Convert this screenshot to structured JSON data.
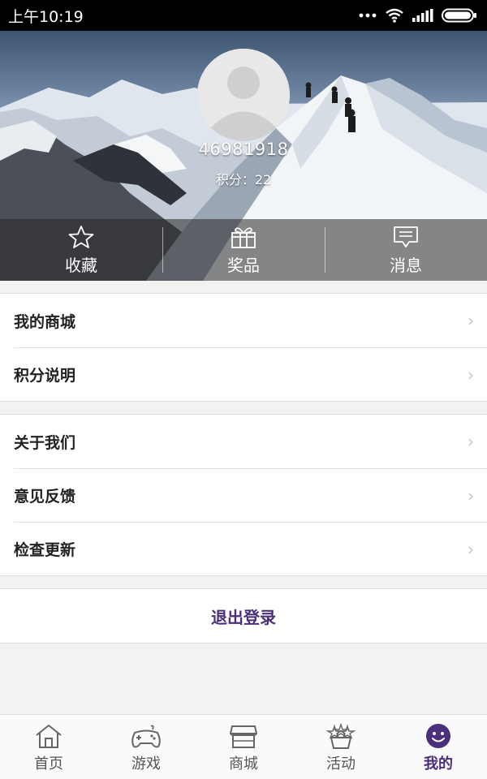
{
  "status_bar": {
    "time": "上午10:19",
    "icons": [
      "more-dots-icon",
      "wifi-icon",
      "signal-icon",
      "battery-icon"
    ]
  },
  "profile": {
    "user_id": "46981918",
    "points": "积分：22",
    "avatar_icon": "default-avatar-icon"
  },
  "quick_actions": [
    {
      "label": "收藏",
      "icon": "star-icon"
    },
    {
      "label": "奖品",
      "icon": "gift-icon"
    },
    {
      "label": "消息",
      "icon": "message-icon"
    }
  ],
  "menu_group_1": [
    {
      "label": "我的商城"
    },
    {
      "label": "积分说明"
    }
  ],
  "menu_group_2": [
    {
      "label": "关于我们"
    },
    {
      "label": "意见反馈"
    },
    {
      "label": "检查更新"
    }
  ],
  "logout_label": "退出登录",
  "bottom_nav": [
    {
      "label": "首页",
      "icon": "home-icon",
      "active": false
    },
    {
      "label": "游戏",
      "icon": "gamepad-icon",
      "active": false
    },
    {
      "label": "商城",
      "icon": "shop-icon",
      "active": false
    },
    {
      "label": "活动",
      "icon": "activity-icon",
      "active": false
    },
    {
      "label": "我的",
      "icon": "profile-smile-icon",
      "active": true
    }
  ],
  "colors": {
    "accent": "#4b2f7a",
    "status_bar": "#000000",
    "background": "#f2f2f2"
  }
}
